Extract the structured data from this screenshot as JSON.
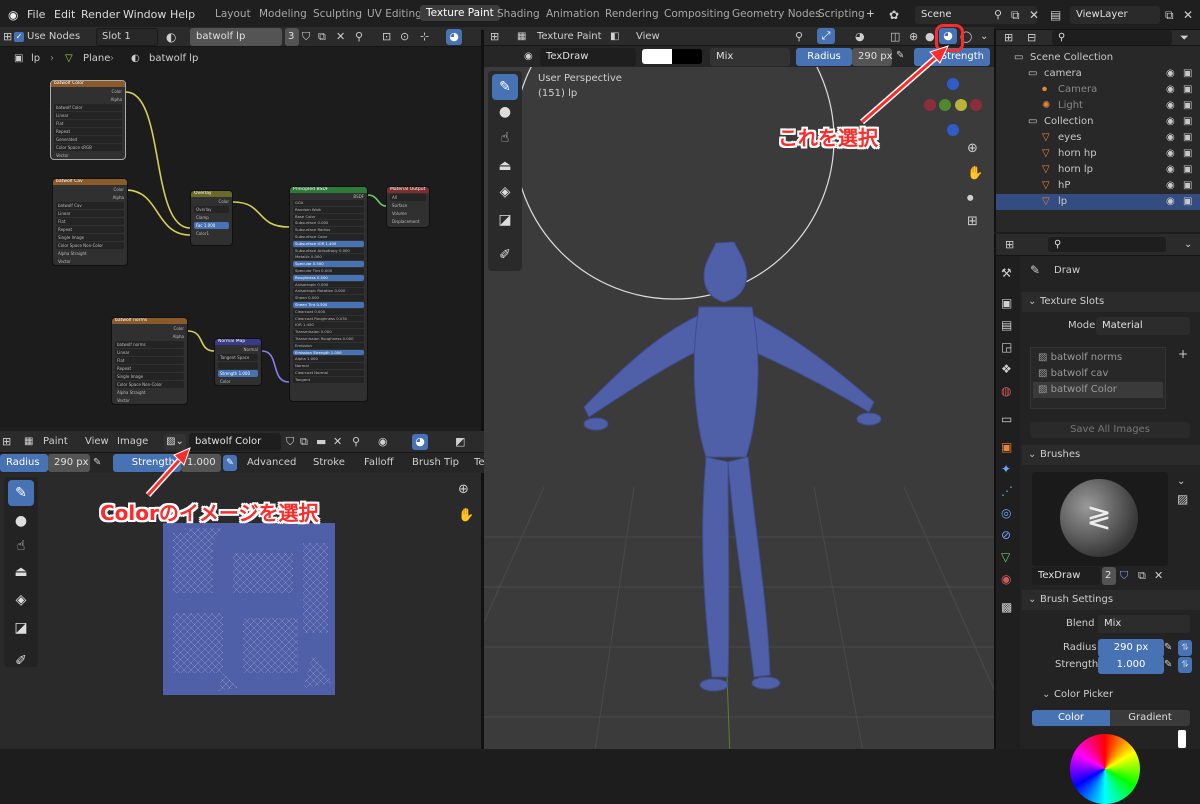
{
  "topbar": {
    "menus": [
      "File",
      "Edit",
      "Render",
      "Window",
      "Help"
    ],
    "workspaces": [
      "Layout",
      "Modeling",
      "Sculpting",
      "UV Editing",
      "Texture Paint",
      "Shading",
      "Animation",
      "Rendering",
      "Compositing",
      "Geometry Nodes",
      "Scripting"
    ],
    "active_workspace": "Texture Paint",
    "plus": "+",
    "scene": "Scene",
    "view_layer": "ViewLayer"
  },
  "node_editor": {
    "use_nodes": "Use Nodes",
    "slot": "Slot 1",
    "material": "batwolf lp",
    "users": "3",
    "breadcrumb": [
      "lp",
      "Plane",
      "batwolf lp"
    ],
    "nodes": {
      "img_color": {
        "title": "batwolf Color",
        "rows": [
          "batwolf Color",
          "Linear",
          "Flat",
          "Repeat",
          "Generated",
          "Color Space   sRGB",
          "Vector"
        ],
        "outs": [
          "Color",
          "Alpha"
        ]
      },
      "img_cav": {
        "title": "batwolf Cav",
        "rows": [
          "batwolf Cav",
          "Linear",
          "Flat",
          "Repeat",
          "Single Image",
          "Color Space   Non-Color",
          "Alpha   Straight",
          "Vector"
        ],
        "outs": [
          "Color",
          "Alpha"
        ]
      },
      "overlay": {
        "title": "Overlay",
        "rows": [
          "Overlay",
          "Clamp",
          "Fac  1.000",
          "Color1",
          "Color2"
        ],
        "outs": [
          "Color"
        ]
      },
      "bsdf": {
        "title": "Principled BSDF",
        "rows": [
          "GGX",
          "Random Walk",
          "Base Color",
          "Subsurface  0.000",
          "Subsurface Radius",
          "Subsurface Color",
          "Subsurface IOR  1.400",
          "Subsurface Anisotropy  0.000",
          "Metallic  0.000",
          "Specular  0.500",
          "Specular Tint  0.000",
          "Roughness  0.500",
          "Anisotropic  0.000",
          "Anisotropic Rotation  0.000",
          "Sheen  0.000",
          "Sheen Tint  0.500",
          "Clearcoat  0.000",
          "Clearcoat Roughness  0.030",
          "IOR  1.450",
          "Transmission  0.000",
          "Transmission Roughness  0.000",
          "Emission",
          "Emission Strength  1.000",
          "Alpha  1.000",
          "Normal",
          "Clearcoat Normal",
          "Tangent"
        ],
        "outs": [
          "BSDF"
        ]
      },
      "output": {
        "title": "Material Output",
        "rows": [
          "All",
          "Surface",
          "Volume",
          "Displacement"
        ]
      },
      "img_norms": {
        "title": "batwolf norms",
        "rows": [
          "batwolf norms",
          "Linear",
          "Flat",
          "Repeat",
          "Single Image",
          "Color Space   Non-Color",
          "Alpha   Straight",
          "Vector"
        ],
        "outs": [
          "Color",
          "Alpha"
        ]
      },
      "normal_map": {
        "title": "Normal Map",
        "rows": [
          "Tangent Space",
          "",
          "Strength  1.000",
          "Color"
        ],
        "outs": [
          "Normal"
        ]
      }
    }
  },
  "image_editor": {
    "mode": "Paint",
    "menus": [
      "View",
      "Image"
    ],
    "image": "batwolf Color",
    "radius_label": "Radius",
    "radius": "290 px",
    "strength_label": "Strength",
    "strength": "1.000",
    "menus2": [
      "Advanced",
      "Stroke",
      "Falloff",
      "Brush Tip",
      "Te"
    ]
  },
  "viewport": {
    "mode": "Texture Paint",
    "view": "View",
    "brush": "TexDraw",
    "blend": "Mix",
    "radius_label": "Radius",
    "radius": "290 px",
    "strength_label": "Strength",
    "info1": "User Perspective",
    "info2": "(151) lp"
  },
  "annotations": {
    "top": "これを選択",
    "bottom": "Colorのイメージを選択"
  },
  "outliner": {
    "items": [
      {
        "name": "Scene Collection",
        "indent": 0
      },
      {
        "name": "camera",
        "indent": 1
      },
      {
        "name": "Camera",
        "indent": 2
      },
      {
        "name": "Light",
        "indent": 2
      },
      {
        "name": "Collection",
        "indent": 1
      },
      {
        "name": "eyes",
        "indent": 2
      },
      {
        "name": "horn hp",
        "indent": 2
      },
      {
        "name": "horn lp",
        "indent": 2
      },
      {
        "name": "hP",
        "indent": 2
      },
      {
        "name": "lp",
        "indent": 2,
        "selected": true
      }
    ]
  },
  "properties": {
    "tool": "Draw",
    "texture_slots": "Texture Slots",
    "mode_label": "Mode",
    "mode": "Material",
    "slots": [
      "batwolf norms",
      "batwolf cav",
      "batwolf Color"
    ],
    "save_all": "Save All Images",
    "brushes": "Brushes",
    "brush_name": "TexDraw",
    "brush_users": "2",
    "brush_settings": "Brush Settings",
    "blend_label": "Blend",
    "blend": "Mix",
    "radius_label": "Radius",
    "radius": "290 px",
    "strength_label": "Strength",
    "strength": "1.000",
    "color_picker": "Color Picker",
    "tab_color": "Color",
    "tab_gradient": "Gradient"
  },
  "colors": {
    "accent": "#4772b3",
    "selected": "#334d80",
    "annotation": "#ff2a2a",
    "mesh": "#4f5fa8"
  }
}
